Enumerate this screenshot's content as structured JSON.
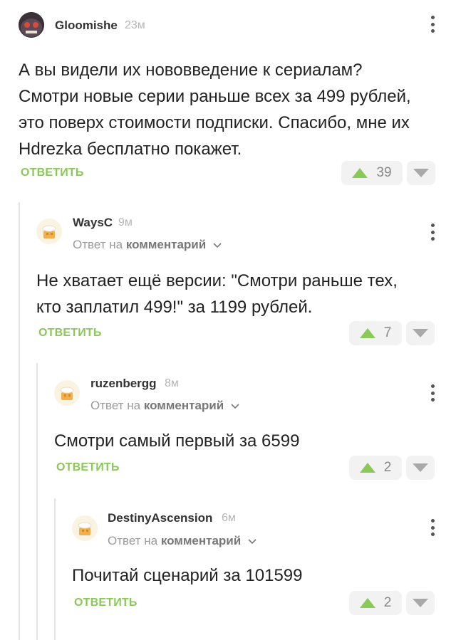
{
  "comments": [
    {
      "username": "Gloomishe",
      "time": "23м",
      "reply_to_prefix": "",
      "reply_to_link": "",
      "text": "А вы видели их нововведение к сериалам?\nСмотри новые серии раньше всех за 499 рублей,\nэто поверх стоимости подписки. Спасибо, мне их\nHdrezka бесплатно покажет.",
      "reply_label": "ОТВЕТИТЬ",
      "votes": "39",
      "avatar": "dark-monster-avatar"
    },
    {
      "username": "WaysC",
      "time": "9м",
      "reply_to_prefix": "Ответ на",
      "reply_to_link": "комментарий",
      "text": "Не хватает ещё версии: \"Смотри раньше тех,\nкто заплатил 499!\" за 1199 рублей.",
      "reply_label": "ОТВЕТИТЬ",
      "votes": "7",
      "avatar": "default-avatar"
    },
    {
      "username": "ruzenbergg",
      "time": "8м",
      "reply_to_prefix": "Ответ на",
      "reply_to_link": "комментарий",
      "text": "Смотри самый первый за 6599",
      "reply_label": "ОТВЕТИТЬ",
      "votes": "2",
      "avatar": "default-avatar"
    },
    {
      "username": "DestinyAscension",
      "time": "6м",
      "reply_to_prefix": "Ответ на",
      "reply_to_link": "комментарий",
      "text": "Почитай сценарий за 101599",
      "reply_label": "ОТВЕТИТЬ",
      "votes": "2",
      "avatar": "default-avatar"
    }
  ],
  "colors": {
    "accent_green": "#8ac858",
    "vote_bg": "#f2f2f2",
    "thread_line": "#e3e3e3"
  }
}
